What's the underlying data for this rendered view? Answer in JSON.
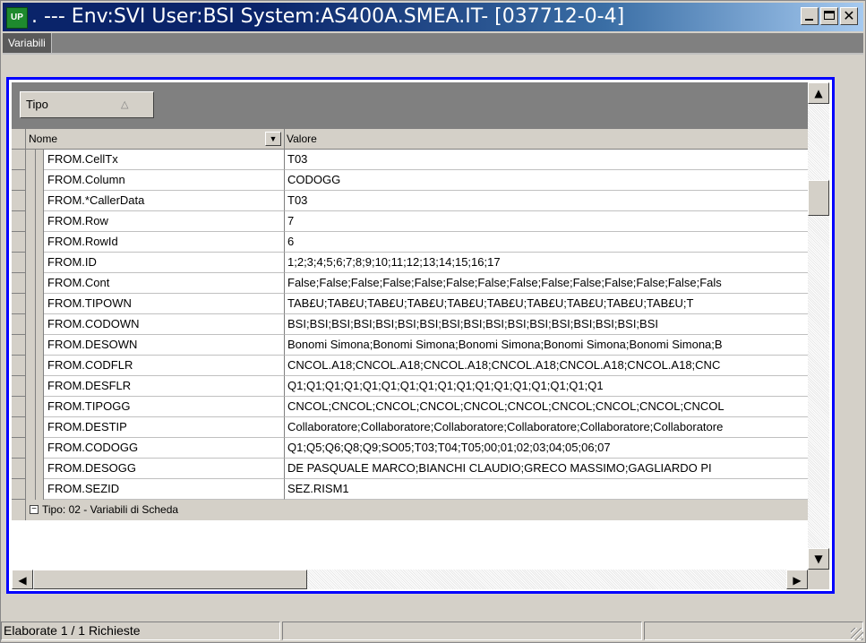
{
  "window": {
    "title": ". --- Env:SVI User:BSI System:AS400A.SMEA.IT- [037712-0-4]",
    "app_icon_text": "UP"
  },
  "tabs": [
    {
      "label": "Variabili"
    }
  ],
  "group_panel": {
    "chip_label": "Tipo"
  },
  "grid": {
    "headers": {
      "name": "Nome",
      "value": "Valore"
    },
    "rows": [
      {
        "name": "FROM.CellTx",
        "value": "T03"
      },
      {
        "name": "FROM.Column",
        "value": "CODOGG"
      },
      {
        "name": "FROM.*CallerData",
        "value": "T03"
      },
      {
        "name": "FROM.Row",
        "value": "7"
      },
      {
        "name": "FROM.RowId",
        "value": "6"
      },
      {
        "name": "FROM.ID",
        "value": "1;2;3;4;5;6;7;8;9;10;11;12;13;14;15;16;17"
      },
      {
        "name": "FROM.Cont",
        "value": "False;False;False;False;False;False;False;False;False;False;False;False;False;Fals"
      },
      {
        "name": "FROM.TIPOWN",
        "value": "TAB£U;TAB£U;TAB£U;TAB£U;TAB£U;TAB£U;TAB£U;TAB£U;TAB£U;TAB£U;T"
      },
      {
        "name": "FROM.CODOWN",
        "value": "BSI;BSI;BSI;BSI;BSI;BSI;BSI;BSI;BSI;BSI;BSI;BSI;BSI;BSI;BSI;BSI;BSI"
      },
      {
        "name": "FROM.DESOWN",
        "value": "Bonomi Simona;Bonomi Simona;Bonomi Simona;Bonomi Simona;Bonomi Simona;B"
      },
      {
        "name": "FROM.CODFLR",
        "value": "CNCOL.A18;CNCOL.A18;CNCOL.A18;CNCOL.A18;CNCOL.A18;CNCOL.A18;CNC"
      },
      {
        "name": "FROM.DESFLR",
        "value": "Q1;Q1;Q1;Q1;Q1;Q1;Q1;Q1;Q1;Q1;Q1;Q1;Q1;Q1;Q1;Q1;Q1"
      },
      {
        "name": "FROM.TIPOGG",
        "value": "CNCOL;CNCOL;CNCOL;CNCOL;CNCOL;CNCOL;CNCOL;CNCOL;CNCOL;CNCOL"
      },
      {
        "name": "FROM.DESTIP",
        "value": "Collaboratore;Collaboratore;Collaboratore;Collaboratore;Collaboratore;Collaboratore"
      },
      {
        "name": "FROM.CODOGG",
        "value": "Q1;Q5;Q6;Q8;Q9;SO05;T03;T04;T05;00;01;02;03;04;05;06;07"
      },
      {
        "name": "FROM.DESOGG",
        "value": "DE PASQUALE MARCO;BIANCHI CLAUDIO;GRECO MASSIMO;GAGLIARDO PI"
      },
      {
        "name": "FROM.SEZID",
        "value": "SEZ.RISM1"
      }
    ],
    "group_row": {
      "expander": "−",
      "label": "Tipo: 02 - Variabili di Scheda"
    }
  },
  "statusbar": {
    "text": "Elaborate 1 / 1 Richieste"
  },
  "icons": {
    "sort_asc": "△",
    "dropdown": "▼",
    "scroll_up": "▲",
    "scroll_down": "▼",
    "scroll_left": "◀",
    "scroll_right": "▶",
    "close": "✕"
  }
}
